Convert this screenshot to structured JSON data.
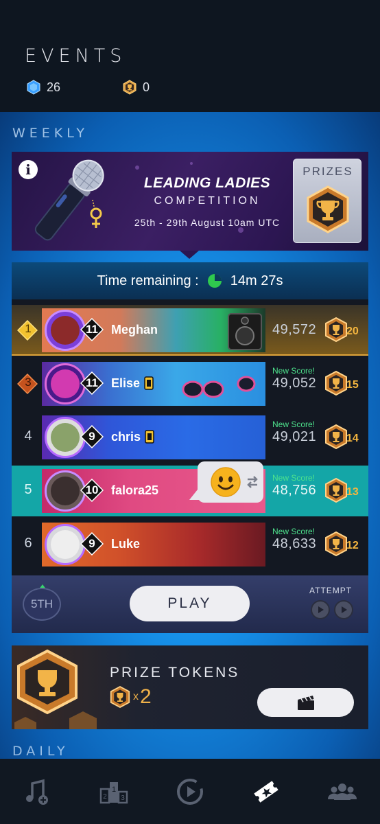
{
  "header": {
    "title": "EVENTS",
    "gems": "26",
    "trophies": "0"
  },
  "weekly": {
    "section_label": "WEEKLY",
    "banner": {
      "title": "LEADING LADIES",
      "subtitle": "COMPETITION",
      "dates": "25th - 29th August 10am UTC",
      "prizes_label": "PRIZES"
    }
  },
  "leaderboard": {
    "time_label": "Time remaining :",
    "time_value": "14m 27s",
    "rows": [
      {
        "rank": "1",
        "level": "11",
        "name": "Meghan",
        "score": "49,572",
        "reward": "20",
        "new_score": "",
        "vip": false
      },
      {
        "rank": "3",
        "level": "11",
        "name": "Elise",
        "score": "49,052",
        "reward": "15",
        "new_score": "New Score!",
        "vip": true
      },
      {
        "rank": "4",
        "level": "9",
        "name": "chris",
        "score": "49,021",
        "reward": "14",
        "new_score": "New Score!",
        "vip": true
      },
      {
        "rank": "5",
        "level": "10",
        "name": "falora25",
        "score": "48,756",
        "reward": "13",
        "new_score": "New Score!",
        "vip": false
      },
      {
        "rank": "6",
        "level": "9",
        "name": "Luke",
        "score": "48,633",
        "reward": "12",
        "new_score": "New Score!",
        "vip": false
      }
    ],
    "place": "5TH",
    "play_label": "PLAY",
    "attempt_label": "ATTEMPT"
  },
  "prize_tokens": {
    "title": "PRIZE TOKENS",
    "multiplier": "x",
    "count": "2"
  },
  "daily": {
    "section_label": "DAILY"
  },
  "nav": {
    "items": [
      "music-add-icon",
      "leaderboard-podium-icon",
      "play-circle-icon",
      "ticket-star-icon",
      "friends-icon"
    ],
    "active": "ticket-star-icon"
  },
  "colors": {
    "accent_blue": "#168fe8",
    "gold": "#f0b24a",
    "new_score_green": "#4ee38d",
    "highlight_teal": "#14a6a7"
  }
}
